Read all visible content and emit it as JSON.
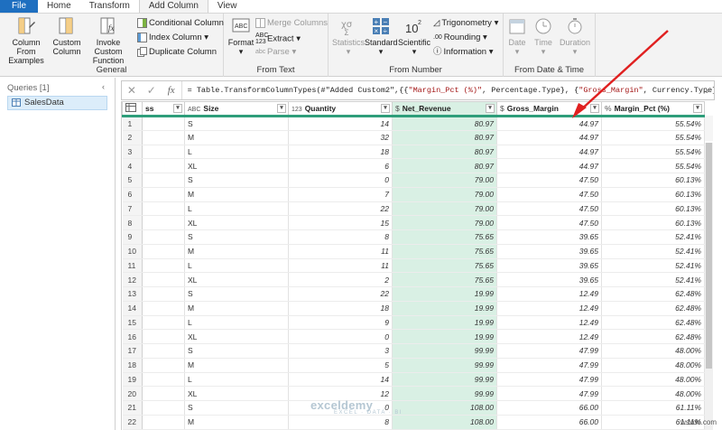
{
  "tabs": [
    "File",
    "Home",
    "Transform",
    "Add Column",
    "View"
  ],
  "ribbon": {
    "general": {
      "label": "General",
      "column_from_examples": "Column From\nExamples",
      "custom_column": "Custom\nColumn",
      "invoke_custom_function": "Invoke Custom\nFunction",
      "conditional_column": "Conditional Column",
      "index_column": "Index Column",
      "duplicate_column": "Duplicate Column"
    },
    "from_text": {
      "label": "From Text",
      "format": "Format",
      "merge_columns": "Merge Columns",
      "extract": "Extract",
      "parse": "Parse"
    },
    "from_number": {
      "label": "From Number",
      "statistics": "Statistics",
      "standard": "Standard",
      "scientific": "Scientific",
      "trigonometry": "Trigonometry",
      "rounding": "Rounding",
      "information": "Information"
    },
    "from_date_time": {
      "label": "From Date & Time",
      "date": "Date",
      "time": "Time",
      "duration": "Duration"
    }
  },
  "queries": {
    "header": "Queries [1]",
    "items": [
      "SalesData"
    ]
  },
  "formula": {
    "prefix": "= Table.TransformColumnTypes(#\"Added Custom2\",{{",
    "s1": "\"Margin_Pct (%)\"",
    "m1": ", Percentage.Type}, {",
    "s2": "\"Gross_Margin\"",
    "m2": ", Currency.Type}"
  },
  "columns": [
    {
      "name": "ss",
      "type": ""
    },
    {
      "name": "Size",
      "type": "ABC"
    },
    {
      "name": "Quantity",
      "type": "123"
    },
    {
      "name": "Net_Revenue",
      "type": "$"
    },
    {
      "name": "Gross_Margin",
      "type": "$"
    },
    {
      "name": "Margin_Pct (%)",
      "type": "%"
    }
  ],
  "rows": [
    [
      "1",
      "",
      "S",
      "14",
      "80.97",
      "44.97",
      "55.54%"
    ],
    [
      "2",
      "",
      "M",
      "32",
      "80.97",
      "44.97",
      "55.54%"
    ],
    [
      "3",
      "",
      "L",
      "18",
      "80.97",
      "44.97",
      "55.54%"
    ],
    [
      "4",
      "",
      "XL",
      "6",
      "80.97",
      "44.97",
      "55.54%"
    ],
    [
      "5",
      "",
      "S",
      "0",
      "79.00",
      "47.50",
      "60.13%"
    ],
    [
      "6",
      "",
      "M",
      "7",
      "79.00",
      "47.50",
      "60.13%"
    ],
    [
      "7",
      "",
      "L",
      "22",
      "79.00",
      "47.50",
      "60.13%"
    ],
    [
      "8",
      "",
      "XL",
      "15",
      "79.00",
      "47.50",
      "60.13%"
    ],
    [
      "9",
      "",
      "S",
      "8",
      "75.65",
      "39.65",
      "52.41%"
    ],
    [
      "10",
      "",
      "M",
      "11",
      "75.65",
      "39.65",
      "52.41%"
    ],
    [
      "11",
      "",
      "L",
      "11",
      "75.65",
      "39.65",
      "52.41%"
    ],
    [
      "12",
      "",
      "XL",
      "2",
      "75.65",
      "39.65",
      "52.41%"
    ],
    [
      "13",
      "",
      "S",
      "22",
      "19.99",
      "12.49",
      "62.48%"
    ],
    [
      "14",
      "",
      "M",
      "18",
      "19.99",
      "12.49",
      "62.48%"
    ],
    [
      "15",
      "",
      "L",
      "9",
      "19.99",
      "12.49",
      "62.48%"
    ],
    [
      "16",
      "",
      "XL",
      "0",
      "19.99",
      "12.49",
      "62.48%"
    ],
    [
      "17",
      "",
      "S",
      "3",
      "99.99",
      "47.99",
      "48.00%"
    ],
    [
      "18",
      "",
      "M",
      "5",
      "99.99",
      "47.99",
      "48.00%"
    ],
    [
      "19",
      "",
      "L",
      "14",
      "99.99",
      "47.99",
      "48.00%"
    ],
    [
      "20",
      "",
      "XL",
      "12",
      "99.99",
      "47.99",
      "48.00%"
    ],
    [
      "21",
      "",
      "S",
      "0",
      "108.00",
      "66.00",
      "61.11%"
    ],
    [
      "22",
      "",
      "M",
      "8",
      "108.00",
      "66.00",
      "61.11%"
    ],
    [
      "23",
      "",
      "L",
      "6",
      "108.00",
      "66.00",
      "61.11%"
    ]
  ],
  "watermark": {
    "brand": "exceldemy",
    "tagline": "EXCEL · DATA · BI"
  },
  "site_mark": "wsxdn.com",
  "colors": {
    "file_tab": "#1e6fc0",
    "selected_column": "#d9f0e4",
    "header_underline": "#2e9e7a",
    "annotation_arrow": "#e02020"
  }
}
